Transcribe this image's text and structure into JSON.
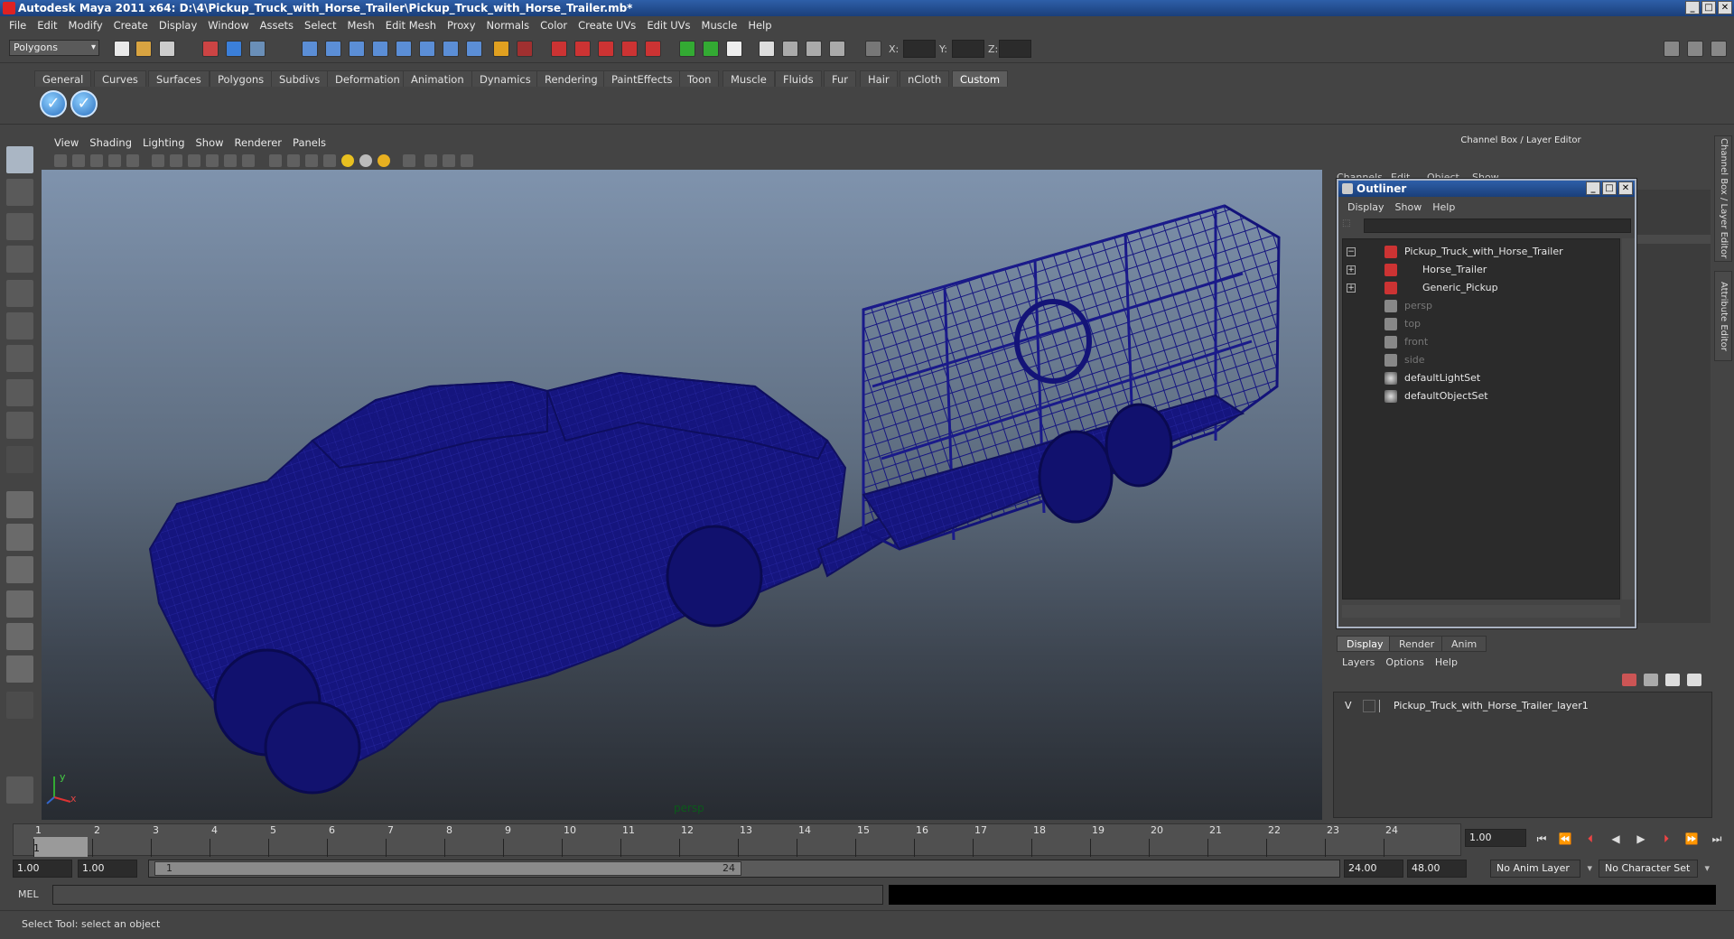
{
  "window": {
    "title": "Autodesk Maya 2011 x64: D:\\4\\Pickup_Truck_with_Horse_Trailer\\Pickup_Truck_with_Horse_Trailer.mb*"
  },
  "menubar": [
    "File",
    "Edit",
    "Modify",
    "Create",
    "Display",
    "Window",
    "Assets",
    "Select",
    "Mesh",
    "Edit Mesh",
    "Proxy",
    "Normals",
    "Color",
    "Create UVs",
    "Edit UVs",
    "Muscle",
    "Help"
  ],
  "statusline": {
    "mode": "Polygons",
    "x_label": "X:",
    "y_label": "Y:",
    "z_label": "Z:"
  },
  "shelf_tabs": [
    "General",
    "Curves",
    "Surfaces",
    "Polygons",
    "Subdivs",
    "Deformation",
    "Animation",
    "Dynamics",
    "Rendering",
    "PaintEffects",
    "Toon",
    "Muscle",
    "Fluids",
    "Fur",
    "Hair",
    "nCloth",
    "Custom"
  ],
  "shelf_active_tab": "Custom",
  "viewport": {
    "menu": [
      "View",
      "Shading",
      "Lighting",
      "Show",
      "Renderer",
      "Panels"
    ],
    "camera_label": "persp",
    "axis_x": "x",
    "axis_y": "y",
    "wire_color": "#14147a"
  },
  "channel_box": {
    "header": "Channel Box / Layer Editor",
    "menu": [
      "Channels",
      "Edit",
      "Object",
      "Show"
    ]
  },
  "side_tabs": [
    "Channel Box / Layer Editor",
    "Attribute Editor"
  ],
  "outliner": {
    "title": "Outliner",
    "menu": [
      "Display",
      "Show",
      "Help"
    ],
    "items": [
      {
        "label": "Pickup_Truck_with_Horse_Trailer",
        "expander": "−",
        "icon": "mesh-icon",
        "indent": 0,
        "dim": false
      },
      {
        "label": "Horse_Trailer",
        "expander": "+",
        "icon": "mesh-icon",
        "indent": 1,
        "dim": false
      },
      {
        "label": "Generic_Pickup",
        "expander": "+",
        "icon": "mesh-icon",
        "indent": 1,
        "dim": false
      },
      {
        "label": "persp",
        "expander": "",
        "icon": "camera-icon",
        "indent": 0,
        "dim": true
      },
      {
        "label": "top",
        "expander": "",
        "icon": "camera-icon",
        "indent": 0,
        "dim": true
      },
      {
        "label": "front",
        "expander": "",
        "icon": "camera-icon",
        "indent": 0,
        "dim": true
      },
      {
        "label": "side",
        "expander": "",
        "icon": "camera-icon",
        "indent": 0,
        "dim": true
      },
      {
        "label": "defaultLightSet",
        "expander": "",
        "icon": "set-icon",
        "indent": 0,
        "dim": false
      },
      {
        "label": "defaultObjectSet",
        "expander": "",
        "icon": "set-icon",
        "indent": 0,
        "dim": false
      }
    ]
  },
  "layer_editor": {
    "tabs": [
      "Display",
      "Render",
      "Anim"
    ],
    "active_tab": "Display",
    "menu": [
      "Layers",
      "Options",
      "Help"
    ],
    "layers": [
      {
        "visible": "V",
        "name": "Pickup_Truck_with_Horse_Trailer_layer1"
      }
    ]
  },
  "timeline": {
    "ticks": [
      "1",
      "2",
      "3",
      "4",
      "5",
      "6",
      "7",
      "8",
      "9",
      "10",
      "11",
      "12",
      "13",
      "14",
      "15",
      "16",
      "17",
      "18",
      "19",
      "20",
      "21",
      "22",
      "23",
      "24"
    ],
    "current_marker": "1",
    "current_frame": "1.00"
  },
  "range": {
    "start": "1.00",
    "playback_start": "1.00",
    "handle_start": "1",
    "handle_end": "24",
    "playback_end": "24.00",
    "end": "48.00",
    "anim_layer": "No Anim Layer",
    "character_set": "No Character Set"
  },
  "command_line": {
    "label": "MEL"
  },
  "help_line": {
    "text": "Select Tool: select an object"
  }
}
